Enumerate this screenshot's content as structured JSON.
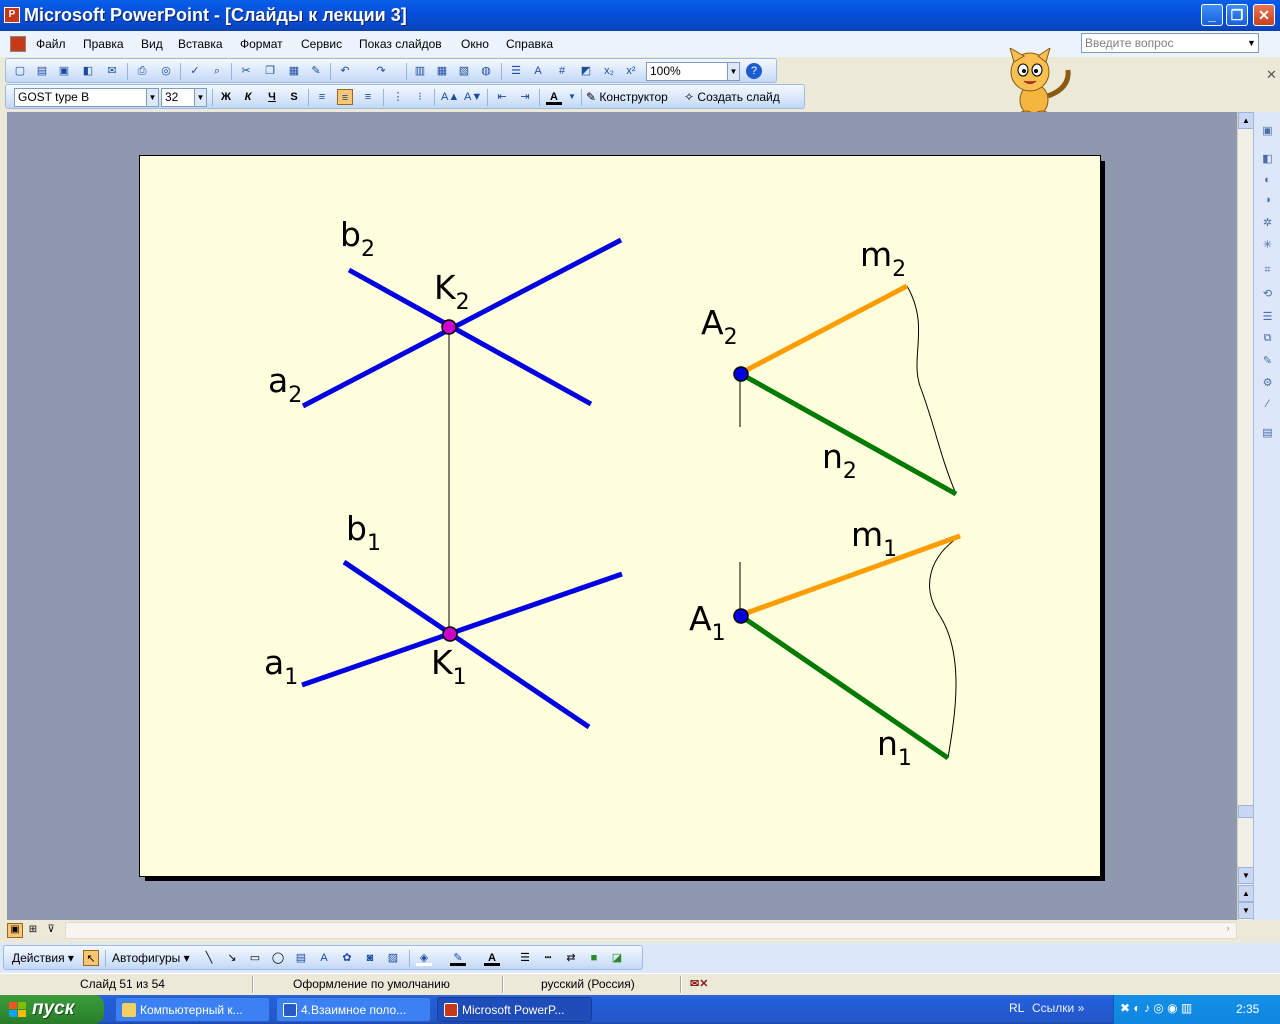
{
  "window": {
    "title": "Microsoft PowerPoint - [Слайды к лекции 3]",
    "app_icon": "powerpoint-icon",
    "buttons": {
      "minimize": "_",
      "maximize": "❐",
      "close": "✕"
    }
  },
  "menu": {
    "items": [
      "Файл",
      "Правка",
      "Вид",
      "Вставка",
      "Формат",
      "Сервис",
      "Показ слайдов",
      "Окно",
      "Справка"
    ],
    "help_placeholder": "Введите вопрос"
  },
  "standard_toolbar": {
    "zoom": "100%"
  },
  "formatting_toolbar": {
    "font": "GOST type B",
    "size": "32",
    "bold": "Ж",
    "italic": "К",
    "underline": "Ч",
    "shadow": "S",
    "designer": "Конструктор",
    "new_slide": "Создать слайд"
  },
  "slide": {
    "background": "#ffffde",
    "labels": {
      "b2": {
        "t": "b",
        "s": "2"
      },
      "k2": {
        "t": "K",
        "s": "2"
      },
      "a2": {
        "t": "a",
        "s": "2"
      },
      "b1": {
        "t": "b",
        "s": "1"
      },
      "k1": {
        "t": "K",
        "s": "1"
      },
      "a1": {
        "t": "a",
        "s": "1"
      },
      "m2": {
        "t": "m",
        "s": "2"
      },
      "A2": {
        "t": "A",
        "s": "2"
      },
      "n2": {
        "t": "n",
        "s": "2"
      },
      "m1": {
        "t": "m",
        "s": "1"
      },
      "A1": {
        "t": "A",
        "s": "1"
      },
      "n1": {
        "t": "n",
        "s": "1"
      }
    },
    "colors": {
      "lines": "#0000e0",
      "point_k": "#cc00cc",
      "point_a": "#0000dd",
      "m": "#ff9d00",
      "n": "#007a00"
    }
  },
  "drawing_toolbar": {
    "actions": "Действия",
    "autoshapes": "Автофигуры"
  },
  "status": {
    "slide": "Слайд 51 из 54",
    "design": "Оформление по умолчанию",
    "language": "русский (Россия)"
  },
  "taskbar": {
    "start": "пуск",
    "tasks": [
      "Компьютерный к...",
      "4.Взаимное поло...",
      "Microsoft PowerP..."
    ],
    "lang": "RL",
    "links": "Ссылки",
    "clock": "2:35"
  }
}
